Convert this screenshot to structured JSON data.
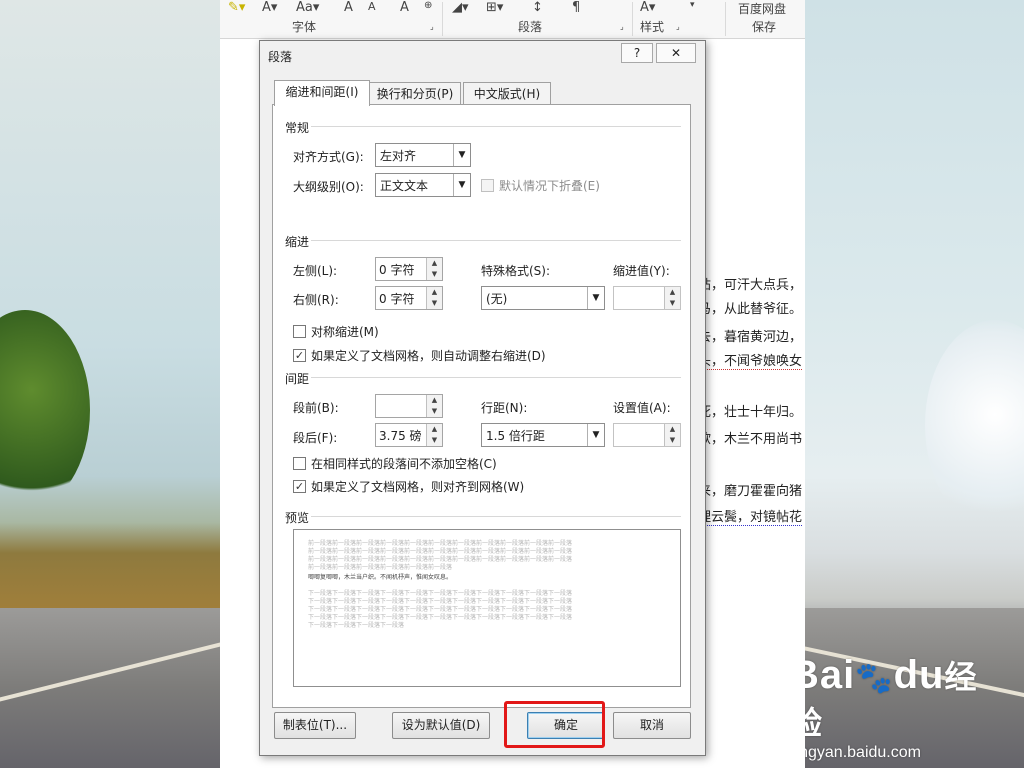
{
  "ribbon": {
    "groups": [
      "字体",
      "段落",
      "样式",
      "保存"
    ],
    "save_app": "百度网盘"
  },
  "document": {
    "lines": [
      {
        "text": "帖，可汗大点兵，",
        "squiggle": false
      },
      {
        "text": "马，从此替爷征。",
        "squiggle": false
      },
      {
        "text": "去，暮宿黄河边，",
        "squiggle": false
      },
      {
        "text": "头，不闻爷娘唤女",
        "squiggle": true
      },
      {
        "text": "死，壮士十年归。",
        "squiggle": false
      },
      {
        "text": "欲，木兰不用尚书",
        "squiggle": false
      },
      {
        "text": "来，磨刀霍霍向猪",
        "squiggle": false
      },
      {
        "text": "理云鬓，对镜帖花",
        "squiggle": true
      }
    ]
  },
  "dialog": {
    "title": "段落",
    "help_label": "?",
    "close_label": "✕",
    "tabs": [
      {
        "label": "缩进和间距(I)",
        "active": true
      },
      {
        "label": "换行和分页(P)",
        "active": false
      },
      {
        "label": "中文版式(H)",
        "active": false
      }
    ],
    "general": {
      "heading": "常规",
      "alignment_label": "对齐方式(G):",
      "alignment_value": "左对齐",
      "outline_label": "大纲级别(O):",
      "outline_value": "正文文本",
      "collapse_label": "默认情况下折叠(E)",
      "collapse_checked": false
    },
    "indent": {
      "heading": "缩进",
      "left_label": "左侧(L):",
      "left_value": "0 字符",
      "right_label": "右侧(R):",
      "right_value": "0 字符",
      "special_label": "特殊格式(S):",
      "special_value": "(无)",
      "by_label": "缩进值(Y):",
      "by_value": "",
      "mirror_label": "对称缩进(M)",
      "mirror_checked": false,
      "grid_label": "如果定义了文档网格，则自动调整右缩进(D)",
      "grid_checked": true
    },
    "spacing": {
      "heading": "间距",
      "before_label": "段前(B):",
      "before_value": "",
      "after_label": "段后(F):",
      "after_value": "3.75 磅",
      "line_label": "行距(N):",
      "line_value": "1.5 倍行距",
      "at_label": "设置值(A):",
      "at_value": "",
      "no_space_label": "在相同样式的段落间不添加空格(C)",
      "no_space_checked": false,
      "snap_label": "如果定义了文档网格，则对齐到网格(W)",
      "snap_checked": true
    },
    "preview": {
      "heading": "预览",
      "prev_lines": [
        "前一段落前一段落前一段落前一段落前一段落前一段落前一段落前一段落前一段落前一段落前一段落",
        "前一段落前一段落前一段落前一段落前一段落前一段落前一段落前一段落前一段落前一段落前一段落",
        "前一段落前一段落前一段落前一段落前一段落前一段落前一段落前一段落前一段落前一段落前一段落",
        "前一段落前一段落前一段落前一段落前一段落前一段落"
      ],
      "current_line": "唧唧复唧唧，木兰当户织。不闻机杼声，惟闻女叹息。",
      "next_lines": [
        "下一段落下一段落下一段落下一段落下一段落下一段落下一段落下一段落下一段落下一段落下一段落",
        "下一段落下一段落下一段落下一段落下一段落下一段落下一段落下一段落下一段落下一段落下一段落",
        "下一段落下一段落下一段落下一段落下一段落下一段落下一段落下一段落下一段落下一段落下一段落",
        "下一段落下一段落下一段落下一段落下一段落下一段落下一段落下一段落下一段落下一段落下一段落",
        "下一段落下一段落下一段落下一段落"
      ]
    },
    "buttons": {
      "tabs": "制表位(T)...",
      "set_default": "设为默认值(D)",
      "ok": "确定",
      "cancel": "取消"
    }
  },
  "watermark": {
    "logo": "Bai",
    "logo2": "du",
    "logo_cn": "经验",
    "url": "jingyan.baidu.com"
  },
  "colors": {
    "highlight": "#e21818",
    "dialog_bg": "#f0f0f0",
    "panel_bg": "#ffffff"
  }
}
